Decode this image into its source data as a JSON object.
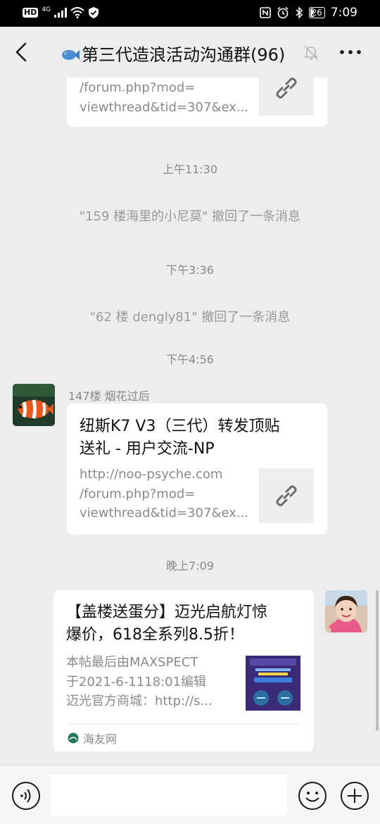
{
  "status_bar": {
    "hd": "HD",
    "network": "4G",
    "battery": "26",
    "time": "7:09"
  },
  "header": {
    "title": "第三代造浪活动沟通群(96)"
  },
  "messages": {
    "card1_partial": {
      "desc_line1": "/forum.php?mod=",
      "desc_line2": "viewthread&tid=307&ex..."
    },
    "time1": "上午11:30",
    "recall1": "\"159 楼海里的小尼莫\" 撤回了一条消息",
    "time2": "下午3:36",
    "recall2": "\"62 楼 dengly81\" 撤回了一条消息",
    "time3": "下午4:56",
    "card2": {
      "sender": "147楼 烟花过后",
      "title_line1": "纽斯K7 V3（三代）转发顶贴",
      "title_line2": "送礼 - 用户交流-NP",
      "desc_line1": "http://noo-psyche.com",
      "desc_line2": "/forum.php?mod=",
      "desc_line3": "viewthread&tid=307&ex..."
    },
    "time4": "晚上7:09",
    "card3": {
      "title_line1": "【盖楼送蛋分】迈光启航灯惊",
      "title_line2": "爆价，618全系列8.5折！",
      "desc_line1": "本帖最后由MAXSPECT",
      "desc_line2": "于2021-6-1118:01编辑",
      "desc_line3": "迈光官方商城：http://s...",
      "source": "海友网"
    }
  },
  "input": {
    "placeholder": ""
  }
}
